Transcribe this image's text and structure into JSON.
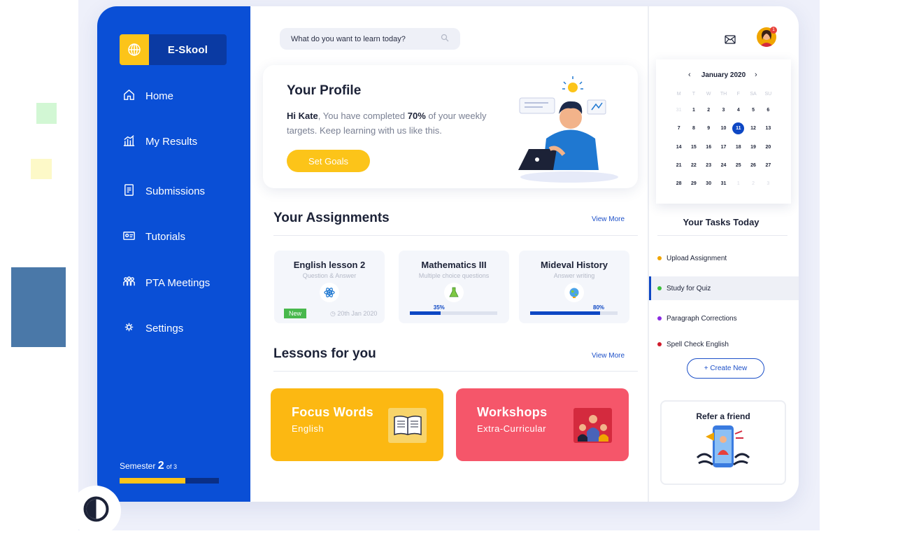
{
  "brand": {
    "name": "E-Skool",
    "icon": "globe-grid-icon"
  },
  "nav": [
    {
      "label": "Home",
      "icon": "home-icon"
    },
    {
      "label": "My Results",
      "icon": "chart-icon"
    },
    {
      "label": "Submissions",
      "icon": "document-icon"
    },
    {
      "label": "Tutorials",
      "icon": "id-card-icon"
    },
    {
      "label": "PTA Meetings",
      "icon": "people-icon"
    },
    {
      "label": "Settings",
      "icon": "gear-icon"
    }
  ],
  "semester": {
    "prefix": "Semester",
    "current": "2",
    "total_text": "of 3",
    "progress": 0.66
  },
  "search": {
    "placeholder": "What do you want to learn today?"
  },
  "profile": {
    "title": "Your Profile",
    "name": "Hi Kate",
    "text_before": ", You have completed ",
    "percent": "70%",
    "text_after": " of your weekly targets. Keep learning with us like this.",
    "button": "Set Goals"
  },
  "assignments": {
    "title": "Your Assignments",
    "view_more": "View More",
    "items": [
      {
        "title": "English lesson 2",
        "subtitle": "Question & Answer",
        "icon": "atom-icon",
        "tag": "New",
        "due": "20th Jan 2020"
      },
      {
        "title": "Mathematics III",
        "subtitle": "Multiple choice questions",
        "icon": "flask-icon",
        "progress_label": "35%",
        "progress": 0.35
      },
      {
        "title": "Mideval History",
        "subtitle": "Answer writing",
        "icon": "globe-icon",
        "progress_label": "80%",
        "progress": 0.8
      }
    ]
  },
  "lessons": {
    "title": "Lessons for you",
    "view_more": "View More",
    "items": [
      {
        "title": "Focus Words",
        "subtitle": "English",
        "color": "#fcb812",
        "icon": "book-icon"
      },
      {
        "title": "Workshops",
        "subtitle": "Extra-Curricular",
        "color": "#f5566a",
        "icon": "group-icon"
      }
    ]
  },
  "calendar": {
    "month": "January 2020",
    "prev": "‹",
    "next": "›",
    "weekdays": [
      "M",
      "T",
      "W",
      "TH",
      "F",
      "SA",
      "SU"
    ],
    "days": [
      "31",
      "1",
      "2",
      "3",
      "4",
      "5",
      "6",
      "7",
      "8",
      "9",
      "10",
      "11",
      "12",
      "13",
      "14",
      "15",
      "16",
      "17",
      "18",
      "19",
      "20",
      "21",
      "22",
      "23",
      "24",
      "25",
      "26",
      "27",
      "28",
      "29",
      "30",
      "31",
      "1",
      "2",
      "3"
    ],
    "today": "11"
  },
  "tasks": {
    "title": "Your Tasks Today",
    "items": [
      {
        "label": "Upload Assignment",
        "color": "#f0a500"
      },
      {
        "label": "Study for Quiz",
        "color": "#3cc03c"
      },
      {
        "label": "Paragraph Corrections",
        "color": "#8a2be2"
      },
      {
        "label": "Spell Check English",
        "color": "#d01c2c"
      }
    ],
    "create_button": "+ Create New"
  },
  "refer": {
    "title": "Refer a friend"
  },
  "header": {
    "mail_icon": "mail-icon",
    "notification_count": "1"
  },
  "colors": {
    "primary": "#0a4fd6",
    "accent": "#fcc419",
    "dark": "#1c2237"
  }
}
